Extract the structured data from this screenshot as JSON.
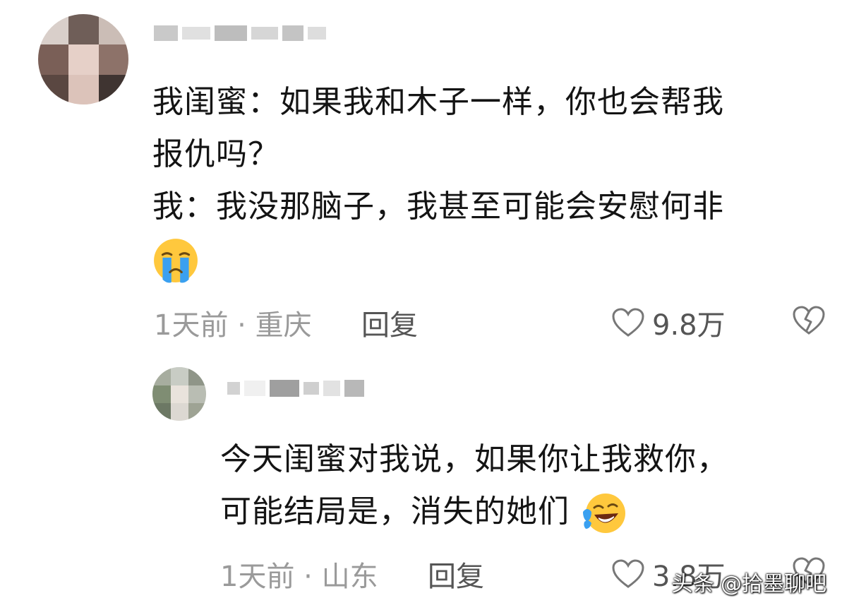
{
  "comments": [
    {
      "lines": [
        "我闺蜜：如果我和木子一样，你也会帮我",
        "报仇吗？",
        "我：我没那脑子，我甚至可能会安慰何非"
      ],
      "emoji": "crying-face-icon",
      "time_location": "1天前 · 重庆",
      "reply_label": "回复",
      "like_count": "9.8万"
    },
    {
      "lines": [
        "今天闺蜜对我说，如果你让我救你，",
        "可能结局是，消失的她们"
      ],
      "emoji": "laughing-tears-face-icon",
      "time_location": "1天前 · 山东",
      "reply_label": "回复",
      "like_count": "3.8万"
    }
  ],
  "watermark": "头条 @拾墨聊吧",
  "colors": {
    "text": "#141414",
    "meta": "#9a9a9a",
    "action": "#555555",
    "emoji_yellow": "#ffc83d",
    "emoji_blue": "#3aa0f0"
  }
}
